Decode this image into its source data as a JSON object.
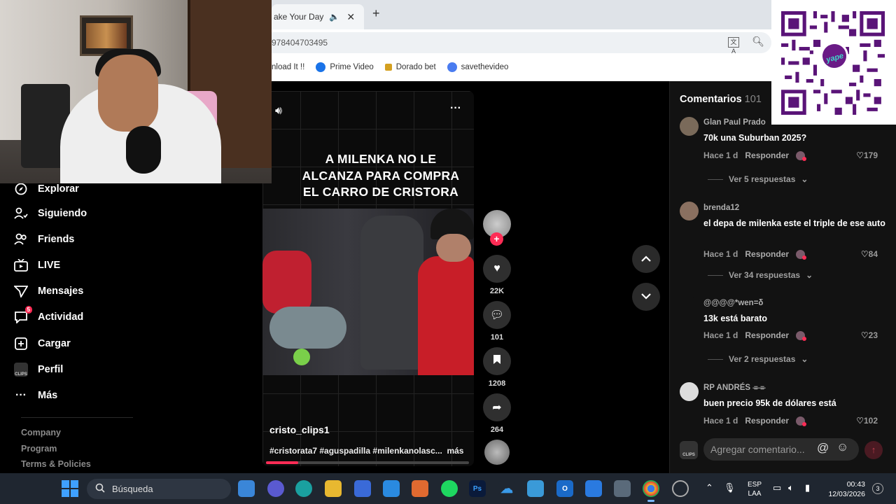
{
  "browser": {
    "tab_title": "ake Your Day",
    "url": "978404703495",
    "bookmarks": [
      {
        "label": "nload It !!",
        "color": "#666666"
      },
      {
        "label": "Prime Video",
        "color": "#1a73e8"
      },
      {
        "label": "Dorado bet",
        "color": "#d4a020"
      },
      {
        "label": "savethevideo",
        "color": "#4a7cf0"
      }
    ]
  },
  "qr": {
    "badge_text": "yape"
  },
  "sidebar": {
    "items": [
      {
        "label": "Explorar",
        "icon": "compass-icon"
      },
      {
        "label": "Siguiendo",
        "icon": "user-follow-icon"
      },
      {
        "label": "Friends",
        "icon": "friends-icon"
      },
      {
        "label": "LIVE",
        "icon": "live-tv-icon"
      },
      {
        "label": "Mensajes",
        "icon": "send-icon"
      },
      {
        "label": "Actividad",
        "icon": "activity-icon",
        "badge": "5"
      },
      {
        "label": "Cargar",
        "icon": "upload-plus-icon"
      },
      {
        "label": "Perfil",
        "icon": "profile-icon",
        "icon_text": "CLIPS"
      },
      {
        "label": "Más",
        "icon": "more-dots-icon"
      }
    ],
    "footer": [
      "Company",
      "Program",
      "Terms & Policies"
    ]
  },
  "video": {
    "caption": "A MILENKA NO LE\nALCANZA PARA COMPRA\nEL CARRO DE CRISTORA",
    "author": "cristo_clips1",
    "hashtags": "#cristorata7 #aguspadilla #milenkanolasc...",
    "more_label": "más",
    "progress": 0.16
  },
  "actions": {
    "likes": "22K",
    "comments": "101",
    "saves": "1208",
    "shares": "264"
  },
  "comments_panel": {
    "title": "Comentarios",
    "count": "101",
    "input_placeholder": "Agregar comentario...",
    "reply_label": "Responder",
    "comments": [
      {
        "user": "Glan Paul Prado",
        "text": "70k una Suburban 2025?",
        "time": "Hace 1 d",
        "likes": "179",
        "replies": "Ver 5 respuestas"
      },
      {
        "user": "brenda12",
        "text": "el depa de milenka este el triple de ese auto",
        "time": "Hace 1 d",
        "likes": "84",
        "replies": "Ver 34 respuestas"
      },
      {
        "user": "@@@@*wen=δ",
        "text": "13k está barato",
        "time": "Hace 1 d",
        "likes": "23",
        "replies": "Ver 2 respuestas"
      },
      {
        "user": "RP ANDRÉS ⌯⌯",
        "text": "buen precio 95k de dólares está",
        "time": "Hace 1 d",
        "likes": "102",
        "replies": ""
      }
    ]
  },
  "taskbar": {
    "search_label": "Búsqueda",
    "lang_top": "ESP",
    "lang_bottom": "LAA",
    "time": "00:43",
    "date": "12/03/2026",
    "notifications": "3"
  }
}
